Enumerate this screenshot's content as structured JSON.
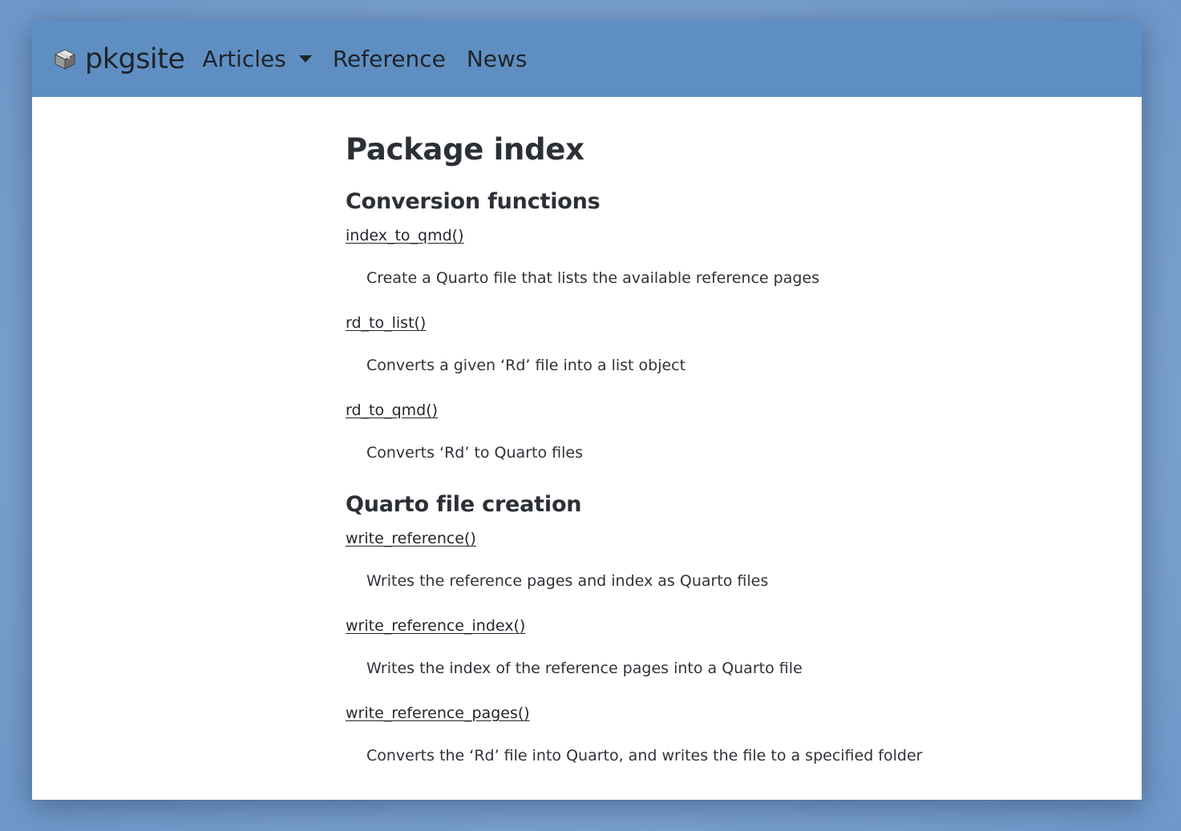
{
  "navbar": {
    "brand": "pkgsite",
    "items": [
      {
        "label": "Articles",
        "has_dropdown": true
      },
      {
        "label": "Reference",
        "has_dropdown": false
      },
      {
        "label": "News",
        "has_dropdown": false
      }
    ]
  },
  "page": {
    "title": "Package index"
  },
  "sections": [
    {
      "heading": "Conversion functions",
      "entries": [
        {
          "name": "index_to_qmd()",
          "description": "Create a Quarto file that lists the available reference pages"
        },
        {
          "name": "rd_to_list()",
          "description": "Converts a given ‘Rd’ file into a list object"
        },
        {
          "name": "rd_to_qmd()",
          "description": "Converts ‘Rd’ to Quarto files"
        }
      ]
    },
    {
      "heading": "Quarto file creation",
      "entries": [
        {
          "name": "write_reference()",
          "description": "Writes the reference pages and index as Quarto files"
        },
        {
          "name": "write_reference_index()",
          "description": "Writes the index of the reference pages into a Quarto file"
        },
        {
          "name": "write_reference_pages()",
          "description": "Converts the ‘Rd’ file into Quarto, and writes the file to a specified folder"
        }
      ]
    }
  ],
  "colors": {
    "navbar": "#5f8fc2",
    "background": "#7fa6d3",
    "text": "#2c3036"
  }
}
